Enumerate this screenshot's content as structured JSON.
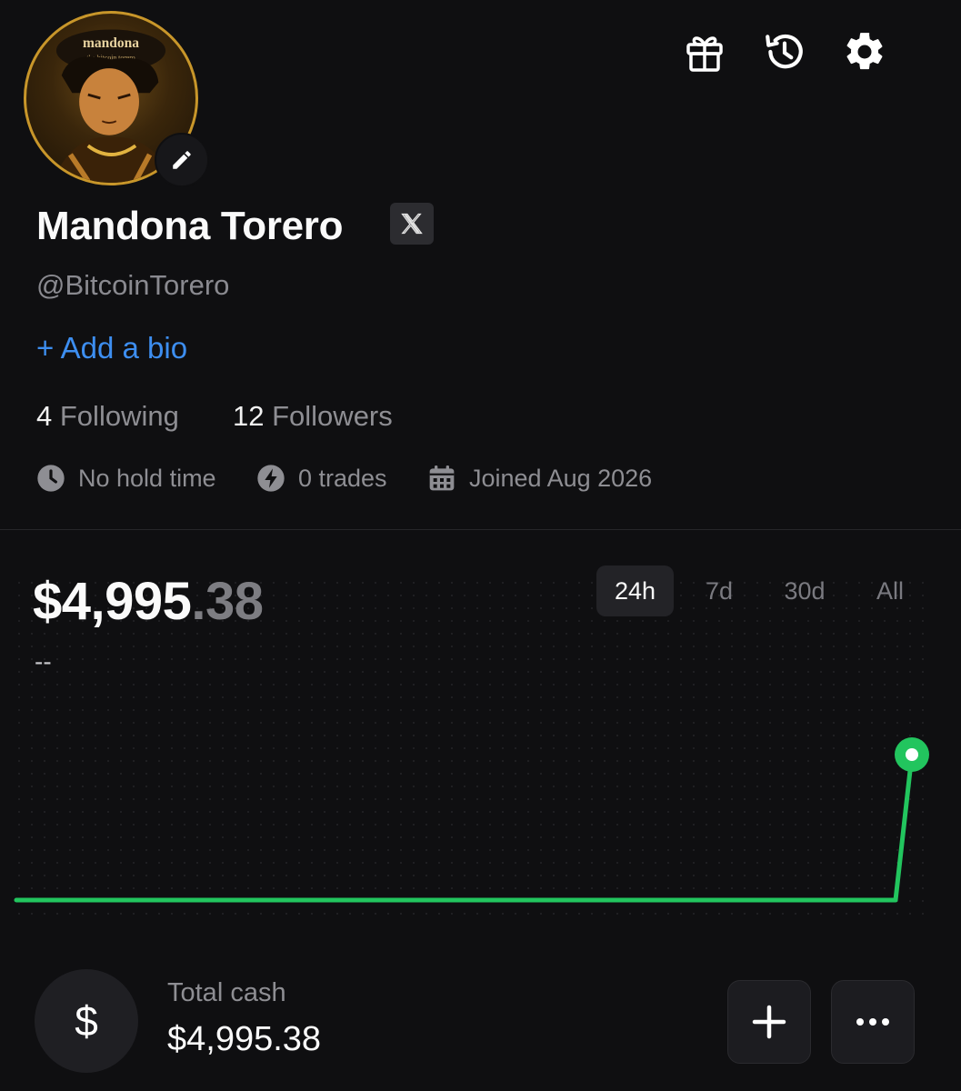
{
  "profile": {
    "name": "Mandona Torero",
    "handle": "@BitcoinTorero",
    "add_bio": "+ Add a bio",
    "avatar_text_line1": "mandona",
    "avatar_text_line2": "the bitcoin torero"
  },
  "stats": {
    "following_count": "4",
    "following_label": "Following",
    "followers_count": "12",
    "followers_label": "Followers"
  },
  "meta": {
    "hold_time": "No hold time",
    "trades": "0 trades",
    "joined": "Joined Aug 2026"
  },
  "portfolio": {
    "balance_main": "$4,995",
    "balance_cents": ".38",
    "change": "--",
    "ranges": [
      "24h",
      "7d",
      "30d",
      "All"
    ],
    "selected_range": "24h"
  },
  "cash": {
    "icon": "$",
    "label": "Total cash",
    "value": "$4,995.38"
  },
  "icons": {
    "gift": "gift-icon",
    "history": "history-icon",
    "settings": "gear-icon",
    "x": "x-logo-icon",
    "edit": "pencil-icon",
    "add": "plus-icon",
    "more": "more-icon"
  },
  "colors": {
    "accent_link": "#3d8ef0",
    "chart_line": "#22c55e",
    "avatar_border": "#c8962a"
  },
  "chart_data": {
    "type": "line",
    "title": "",
    "xlabel": "",
    "ylabel": "",
    "range": "24h",
    "series": [
      {
        "values": [
          0,
          0,
          0,
          0,
          0,
          0,
          0,
          0,
          0,
          0,
          0,
          0,
          0,
          0,
          0,
          0,
          0,
          0,
          0,
          0,
          0,
          0,
          0,
          0,
          4995.38
        ]
      }
    ],
    "grid": true
  }
}
